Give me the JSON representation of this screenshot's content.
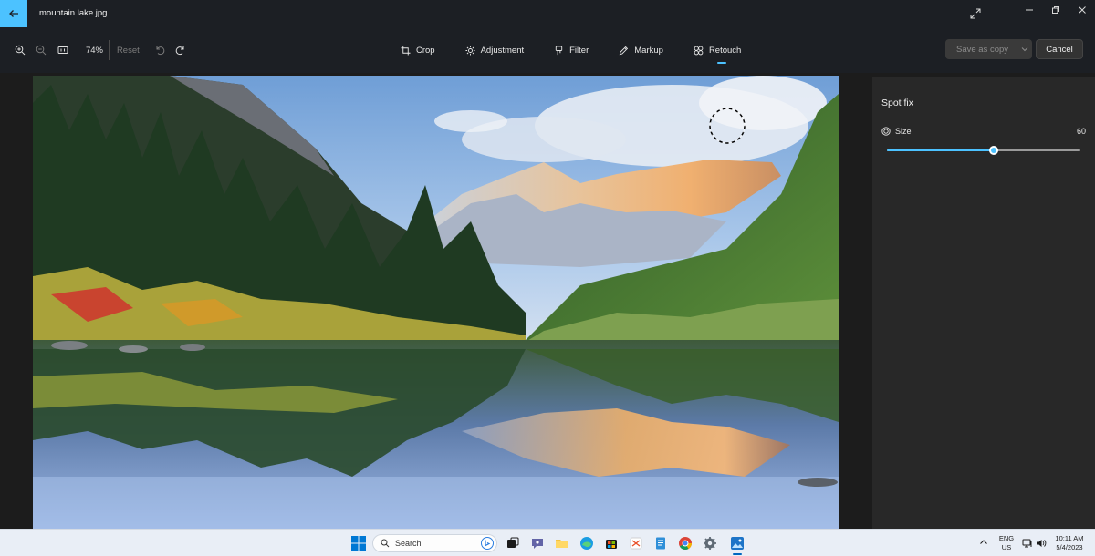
{
  "window": {
    "file_name": "mountain lake.jpg"
  },
  "toolbar": {
    "zoom_level": "74%",
    "reset_label": "Reset",
    "tools": {
      "crop": "Crop",
      "adjustment": "Adjustment",
      "filter": "Filter",
      "markup": "Markup",
      "retouch": "Retouch"
    },
    "active_tool": "retouch",
    "save_as_copy_label": "Save as copy",
    "cancel_label": "Cancel"
  },
  "panel": {
    "title": "Spot fix",
    "size_label": "Size",
    "size_value": "60",
    "size_fraction": 0.55
  },
  "taskbar": {
    "search_placeholder": "Search",
    "lang_primary": "ENG",
    "lang_secondary": "US",
    "time": "10:11 AM",
    "date": "5/4/2023"
  },
  "colors": {
    "accent": "#4cc2ff",
    "titlebar_bg": "#1c1f24",
    "panel_bg": "#282828",
    "taskbar_bg": "#e9eef6"
  },
  "icons": {
    "back": "arrow-left-icon",
    "zoom_in": "zoom-in-icon",
    "zoom_out": "zoom-out-icon",
    "actual_size": "actual-size-icon",
    "undo": "undo-icon",
    "redo": "redo-icon",
    "crop": "crop-icon",
    "adjustment": "sun-icon",
    "filter": "filter-icon",
    "markup": "pen-icon",
    "retouch": "bandage-icon",
    "size": "target-icon"
  }
}
